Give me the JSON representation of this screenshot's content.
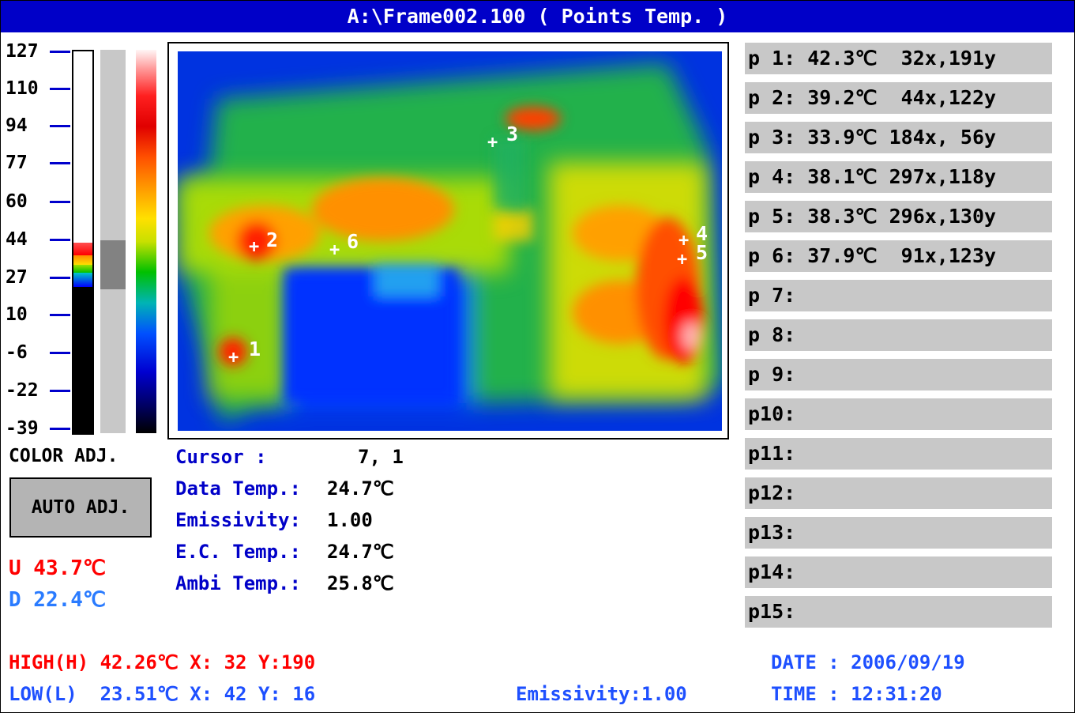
{
  "window": {
    "title": "A:\\Frame002.100 ( Points Temp. )"
  },
  "scale": {
    "ticks": [
      "127",
      "110",
      "94",
      "77",
      "60",
      "44",
      "27",
      "10",
      "-6",
      "-22",
      "-39"
    ],
    "color_adj_label": "COLOR ADJ.",
    "auto_adj_label": "AUTO ADJ.",
    "upper_limit": "U 43.7℃",
    "lower_limit": "D 22.4℃"
  },
  "colors": {
    "title_bar": "#0000c8",
    "label_blue": "#0000c8",
    "alarm_red": "#ff0000",
    "panel_gray": "#c8c8c8"
  },
  "image": {
    "markers": [
      {
        "label": "1",
        "temp": "42.3"
      },
      {
        "label": "2",
        "temp": "39.2"
      },
      {
        "label": "3",
        "temp": "33.9"
      },
      {
        "label": "4",
        "temp": "38.1"
      },
      {
        "label": "5",
        "temp": "38.3"
      },
      {
        "label": "6",
        "temp": "37.9"
      }
    ]
  },
  "info": {
    "cursor_label": "Cursor    :",
    "cursor_value": " 7,  1",
    "data_temp_label": "Data Temp.:",
    "data_temp_value": "24.7℃",
    "emissivity_label": "Emissivity:",
    "emissivity_value": "1.00",
    "ec_temp_label": "E.C. Temp.:",
    "ec_temp_value": "24.7℃",
    "ambi_temp_label": "Ambi Temp.:",
    "ambi_temp_value": "25.8℃"
  },
  "points": [
    "p 1: 42.3℃  32x,191y",
    "p 2: 39.2℃  44x,122y",
    "p 3: 33.9℃ 184x, 56y",
    "p 4: 38.1℃ 297x,118y",
    "p 5: 38.3℃ 296x,130y",
    "p 6: 37.9℃  91x,123y",
    "p 7:",
    "p 8:",
    "p 9:",
    "p10:",
    "p11:",
    "p12:",
    "p13:",
    "p14:",
    "p15:"
  ],
  "footer": {
    "high": "HIGH(H) 42.26℃ X: 32 Y:190",
    "low": "LOW(L)  23.51℃ X: 42 Y: 16",
    "emissivity": "Emissivity:1.00",
    "date": "DATE : 2006/09/19",
    "time": "TIME : 12:31:20"
  }
}
